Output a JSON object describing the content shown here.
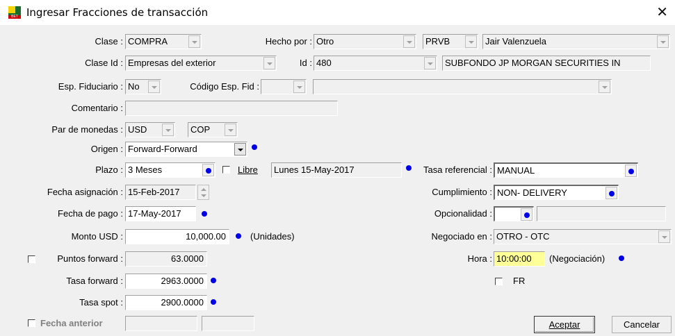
{
  "window": {
    "title": "Ingresar Fracciones de transacción",
    "close_icon": "close-icon",
    "app_icon_text": "BET"
  },
  "labels": {
    "clase": "Clase :",
    "hecho_por": "Hecho por :",
    "clase_id": "Clase Id :",
    "id": "Id :",
    "esp_fiduciario": "Esp. Fiduciario :",
    "codigo_esp_fid": "Código Esp. Fid :",
    "comentario": "Comentario :",
    "par_monedas": "Par de monedas :",
    "origen": "Origen :",
    "plazo": "Plazo :",
    "libre": "Libre",
    "tasa_referencial": "Tasa referencial :",
    "fecha_asignacion": "Fecha asignación :",
    "cumplimiento": "Cumplimiento :",
    "fecha_pago": "Fecha de pago :",
    "opcionalidad": "Opcionalidad :",
    "monto_usd": "Monto USD :",
    "unidades": "(Unidades)",
    "negociado_en": "Negociado en :",
    "puntos_forward": "Puntos forward :",
    "hora": "Hora :",
    "negociacion": "(Negociación)",
    "tasa_forward": "Tasa forward :",
    "fr": "FR",
    "tasa_spot": "Tasa spot :",
    "fecha_anterior": "Fecha anterior"
  },
  "values": {
    "clase": "COMPRA",
    "hecho_por": "Otro",
    "trader_code": "PRVB",
    "trader_name": "Jair Valenzuela",
    "clase_id": "Empresas del exterior",
    "id": "480",
    "id_name": "SUBFONDO JP MORGAN SECURITIES IN",
    "esp_fiduciario": "No",
    "codigo_esp_fid": "",
    "codigo_esp_fid_desc": "",
    "comentario": "",
    "moneda_1": "USD",
    "moneda_2": "COP",
    "origen": "Forward-Forward",
    "plazo": "3 Meses",
    "fecha_plazo": "Lunes 15-May-2017",
    "tasa_referencial": "MANUAL",
    "fecha_asignacion": "15-Feb-2017",
    "cumplimiento": "NON- DELIVERY",
    "fecha_pago": "17-May-2017",
    "opcionalidad": "",
    "opcionalidad_desc": "",
    "monto_usd": "10,000.00",
    "negociado_en": "OTRO - OTC",
    "puntos_forward": "63.0000",
    "hora": "10:00:00",
    "tasa_forward": "2963.0000",
    "tasa_spot": "2900.0000",
    "fecha_anterior_1": "",
    "fecha_anterior_2": ""
  },
  "buttons": {
    "aceptar": "Aceptar",
    "cancelar": "Cancelar"
  },
  "colors": {
    "accent_dot": "#0000e8",
    "hora_bg": "#ffff9a"
  }
}
